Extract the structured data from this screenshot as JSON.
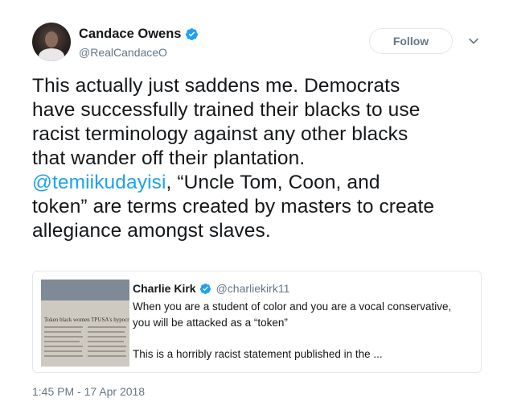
{
  "tweet": {
    "author_name": "Candace Owens",
    "handle": "@RealCandaceO",
    "follow_label": "Follow",
    "text_lines": [
      {
        "pre": "This actually just saddens me. Democrats",
        "mention": "",
        "post": ""
      },
      {
        "pre": "have successfully trained their blacks to use",
        "mention": "",
        "post": ""
      },
      {
        "pre": "racist terminology against any other blacks",
        "mention": "",
        "post": ""
      },
      {
        "pre": "that wander off their plantation.",
        "mention": "",
        "post": ""
      },
      {
        "pre": "",
        "mention": "@temiikudayisi",
        "post": ", “Uncle Tom, Coon, and"
      },
      {
        "pre": "token” are terms created by masters to create",
        "mention": "",
        "post": ""
      },
      {
        "pre": "allegiance amongst slaves.",
        "mention": "",
        "post": ""
      }
    ],
    "timestamp": "1:45 PM - 17 Apr 2018"
  },
  "quote": {
    "author_name": "Charlie Kirk",
    "handle": "@charliekirk11",
    "lines": [
      "When you are a student of color and you are a vocal conservative,",
      "you will be attacked as a “token”",
      "",
      "This is a horribly racist statement published in the ..."
    ],
    "thumbnail_headline": "Token black women TPUSA's hypocrisy"
  },
  "colors": {
    "link": "#1da1f2",
    "secondary_text": "#657786",
    "border": "#e1e8ed",
    "verified": "#1da1f2"
  },
  "icons": {
    "verified": "verified-badge-icon",
    "caret": "chevron-down-icon"
  }
}
